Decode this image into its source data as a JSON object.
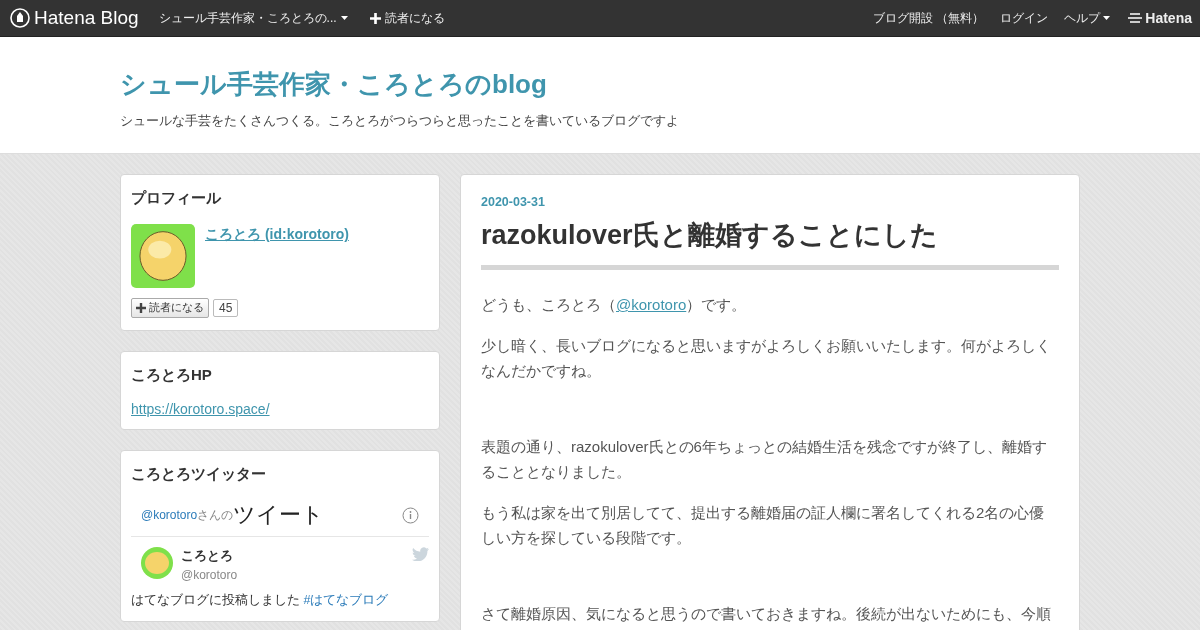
{
  "topbar": {
    "logo": "Hatena Blog",
    "blog_menu": "シュール手芸作家・ころとろの...",
    "subscribe": "読者になる",
    "links": [
      {
        "label": "ブログ開設 （無料）",
        "dropdown": false
      },
      {
        "label": "ログイン",
        "dropdown": false
      },
      {
        "label": "ヘルプ",
        "dropdown": true
      }
    ],
    "brand": "Hatena"
  },
  "header": {
    "title": "シュール手芸作家・ころとろのblog",
    "description": "シュールな手芸をたくさんつくる。ころとろがつらつらと思ったことを書いているブログですよ"
  },
  "sidebar": [
    {
      "kind": "profile",
      "title": "プロフィール",
      "name": "ころとろ (id:korotoro)",
      "subscribe": "読者になる",
      "count": "45"
    },
    {
      "kind": "link",
      "title": "ころとろHP",
      "url": "https://korotoro.space/"
    },
    {
      "kind": "twitter",
      "title": "ころとろツイッター",
      "handle": "@korotoro",
      "handle_suffix": "さんの",
      "heading": "ツイート",
      "tweet": {
        "name": "ころとろ",
        "handle": "@korotoro",
        "parts": [
          {
            "kind": "text",
            "text": "はてなブログに投稿しました "
          },
          {
            "kind": "link",
            "text": "#はてなブログ"
          }
        ]
      }
    }
  ],
  "article": {
    "date": "2020-03-31",
    "title": "razokulover氏と離婚することにした",
    "sections": [
      [
        [
          {
            "kind": "text",
            "text": "どうも、ころとろ（"
          },
          {
            "kind": "link",
            "text": "@korotoro"
          },
          {
            "kind": "text",
            "text": "）です。"
          }
        ],
        [
          {
            "kind": "text",
            "text": "少し暗く、長いブログになると思いますがよろしくお願いいたします。何がよろしくなんだかですね。"
          }
        ]
      ],
      [
        [
          {
            "kind": "text",
            "text": "表題の通り、razokulover氏との6年ちょっとの結婚生活を残念ですが終了し、離婚することとなりました。"
          }
        ],
        [
          {
            "kind": "text",
            "text": "もう私は家を出て別居してて、提出する離婚届の証人欄に署名してくれる2名の心優しい方を探している段階です。"
          }
        ]
      ],
      [
        [
          {
            "kind": "text",
            "text": "さて離婚原因、気になると思うので書いておきますね。後続が出ないためにも、今順"
          }
        ]
      ]
    ]
  }
}
